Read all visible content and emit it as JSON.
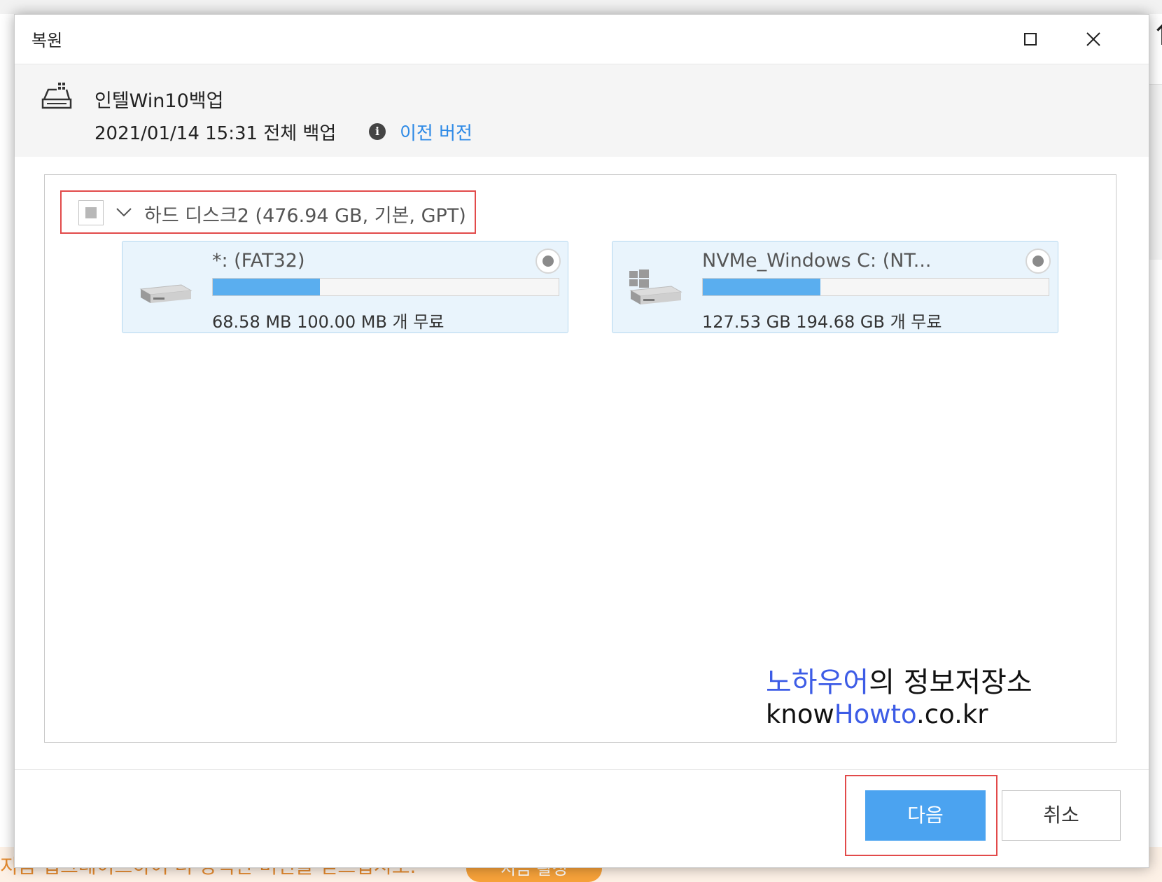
{
  "background": {
    "upgrade_text": "지금 업그레이드하여 더 강력한 버전을 얻으십시오.",
    "activate_label": "지금 활성"
  },
  "dialog": {
    "title": "복원",
    "backup": {
      "name": "인텔Win10백업",
      "date_type": "2021/01/14 15:31 전체 백업",
      "prev_version_link": "이전 버전"
    },
    "disk": {
      "label": "하드 디스크2 (476.94 GB, 기본, GPT)",
      "checked": "partial"
    },
    "partitions": [
      {
        "name": "*: (FAT32)",
        "used_fraction": 0.31,
        "size_text": "68.58 MB 100.00 MB 개 무료",
        "icon": "drive-icon"
      },
      {
        "name": "NVMe_Windows C: (NT...",
        "used_fraction": 0.34,
        "size_text": "127.53 GB 194.68 GB 개 무료",
        "icon": "windows-drive-icon"
      }
    ],
    "watermark": {
      "blue1": "노하우어",
      "dark1": "의 정보저장소",
      "dark2a": "know",
      "blue2": "Howto",
      "dark2b": ".co.kr"
    },
    "buttons": {
      "next": "다음",
      "cancel": "취소"
    }
  },
  "colors": {
    "accent": "#4ba3f0",
    "link": "#2e8ae6",
    "highlight": "#e24a4a",
    "partition_bg": "#e9f4fc",
    "bar_fill": "#5aaeef"
  }
}
